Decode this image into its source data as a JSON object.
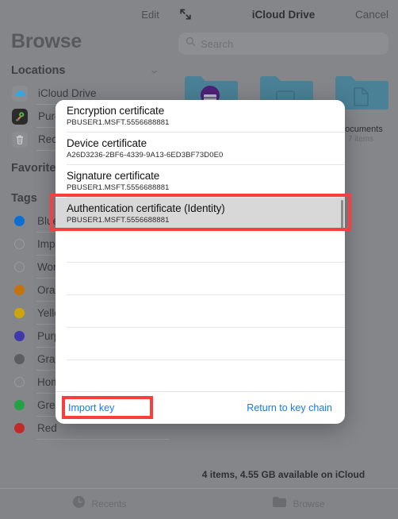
{
  "sidebar": {
    "edit_label": "Edit",
    "title": "Browse",
    "sections": [
      {
        "name": "locations",
        "header": "Locations",
        "chevron_icon": "chevron-down-icon",
        "items": [
          {
            "label": "iCloud Drive",
            "icon": "icloud-icon"
          },
          {
            "label": "Purebred",
            "icon": "purebred-app-icon"
          },
          {
            "label": "Recently Deleted",
            "icon": "trash-icon"
          }
        ]
      },
      {
        "name": "favorites",
        "header": "Favorites",
        "items": []
      },
      {
        "name": "tags",
        "header": "Tags",
        "items": [
          {
            "label": "Blue",
            "color": "#0a6fd4",
            "filled": true
          },
          {
            "label": "Important",
            "color": "",
            "filled": false
          },
          {
            "label": "Work",
            "color": "",
            "filled": false
          },
          {
            "label": "Orange",
            "color": "#c4730a",
            "filled": true
          },
          {
            "label": "Yellow",
            "color": "#cfa50d",
            "filled": true
          },
          {
            "label": "Purple",
            "color": "#4038ad",
            "filled": true
          },
          {
            "label": "Gray",
            "color": "#5c5d61",
            "filled": true
          },
          {
            "label": "Home",
            "color": "",
            "filled": false
          },
          {
            "label": "Green",
            "color": "#22a145",
            "filled": true
          },
          {
            "label": "Red",
            "color": "#c22a2a",
            "filled": true
          }
        ]
      }
    ]
  },
  "content": {
    "expand_icon": "expand-arrows-icon",
    "title": "iCloud Drive",
    "cancel_label": "Cancel",
    "search": {
      "icon": "search-icon",
      "placeholder": "Search"
    },
    "folders": [
      {
        "name": "",
        "count": "",
        "icon": "folder-purple-icon"
      },
      {
        "name": "",
        "count": "",
        "icon": "folder-plain-icon"
      },
      {
        "name": "Documents",
        "count": "7 items",
        "icon": "folder-document-icon"
      }
    ],
    "status": "4 items, 4.55 GB available on iCloud"
  },
  "tabbar": {
    "tabs": [
      {
        "label": "Recents",
        "icon": "clock-icon"
      },
      {
        "label": "Browse",
        "icon": "folder-icon"
      }
    ]
  },
  "modal": {
    "certificates": [
      {
        "title": "Encryption certificate",
        "subtitle": "PBUSER1.MSFT.5556688881",
        "selected": false
      },
      {
        "title": "Device certificate",
        "subtitle": "A26D3236-2BF6-4339-9A13-6ED3BF73D0E0",
        "selected": false
      },
      {
        "title": "Signature certificate",
        "subtitle": "PBUSER1.MSFT.5556688881",
        "selected": false
      },
      {
        "title": "Authentication certificate (Identity)",
        "subtitle": "PBUSER1.MSFT.5556688881",
        "selected": true
      }
    ],
    "empty_row_count": 4,
    "footer": {
      "import_label": "Import key",
      "return_label": "Return to key chain"
    }
  },
  "annotations": {
    "highlight_color": "#f73f3f",
    "boxes": [
      {
        "target": "authentication-certificate-row"
      },
      {
        "target": "import-key-button"
      }
    ]
  }
}
